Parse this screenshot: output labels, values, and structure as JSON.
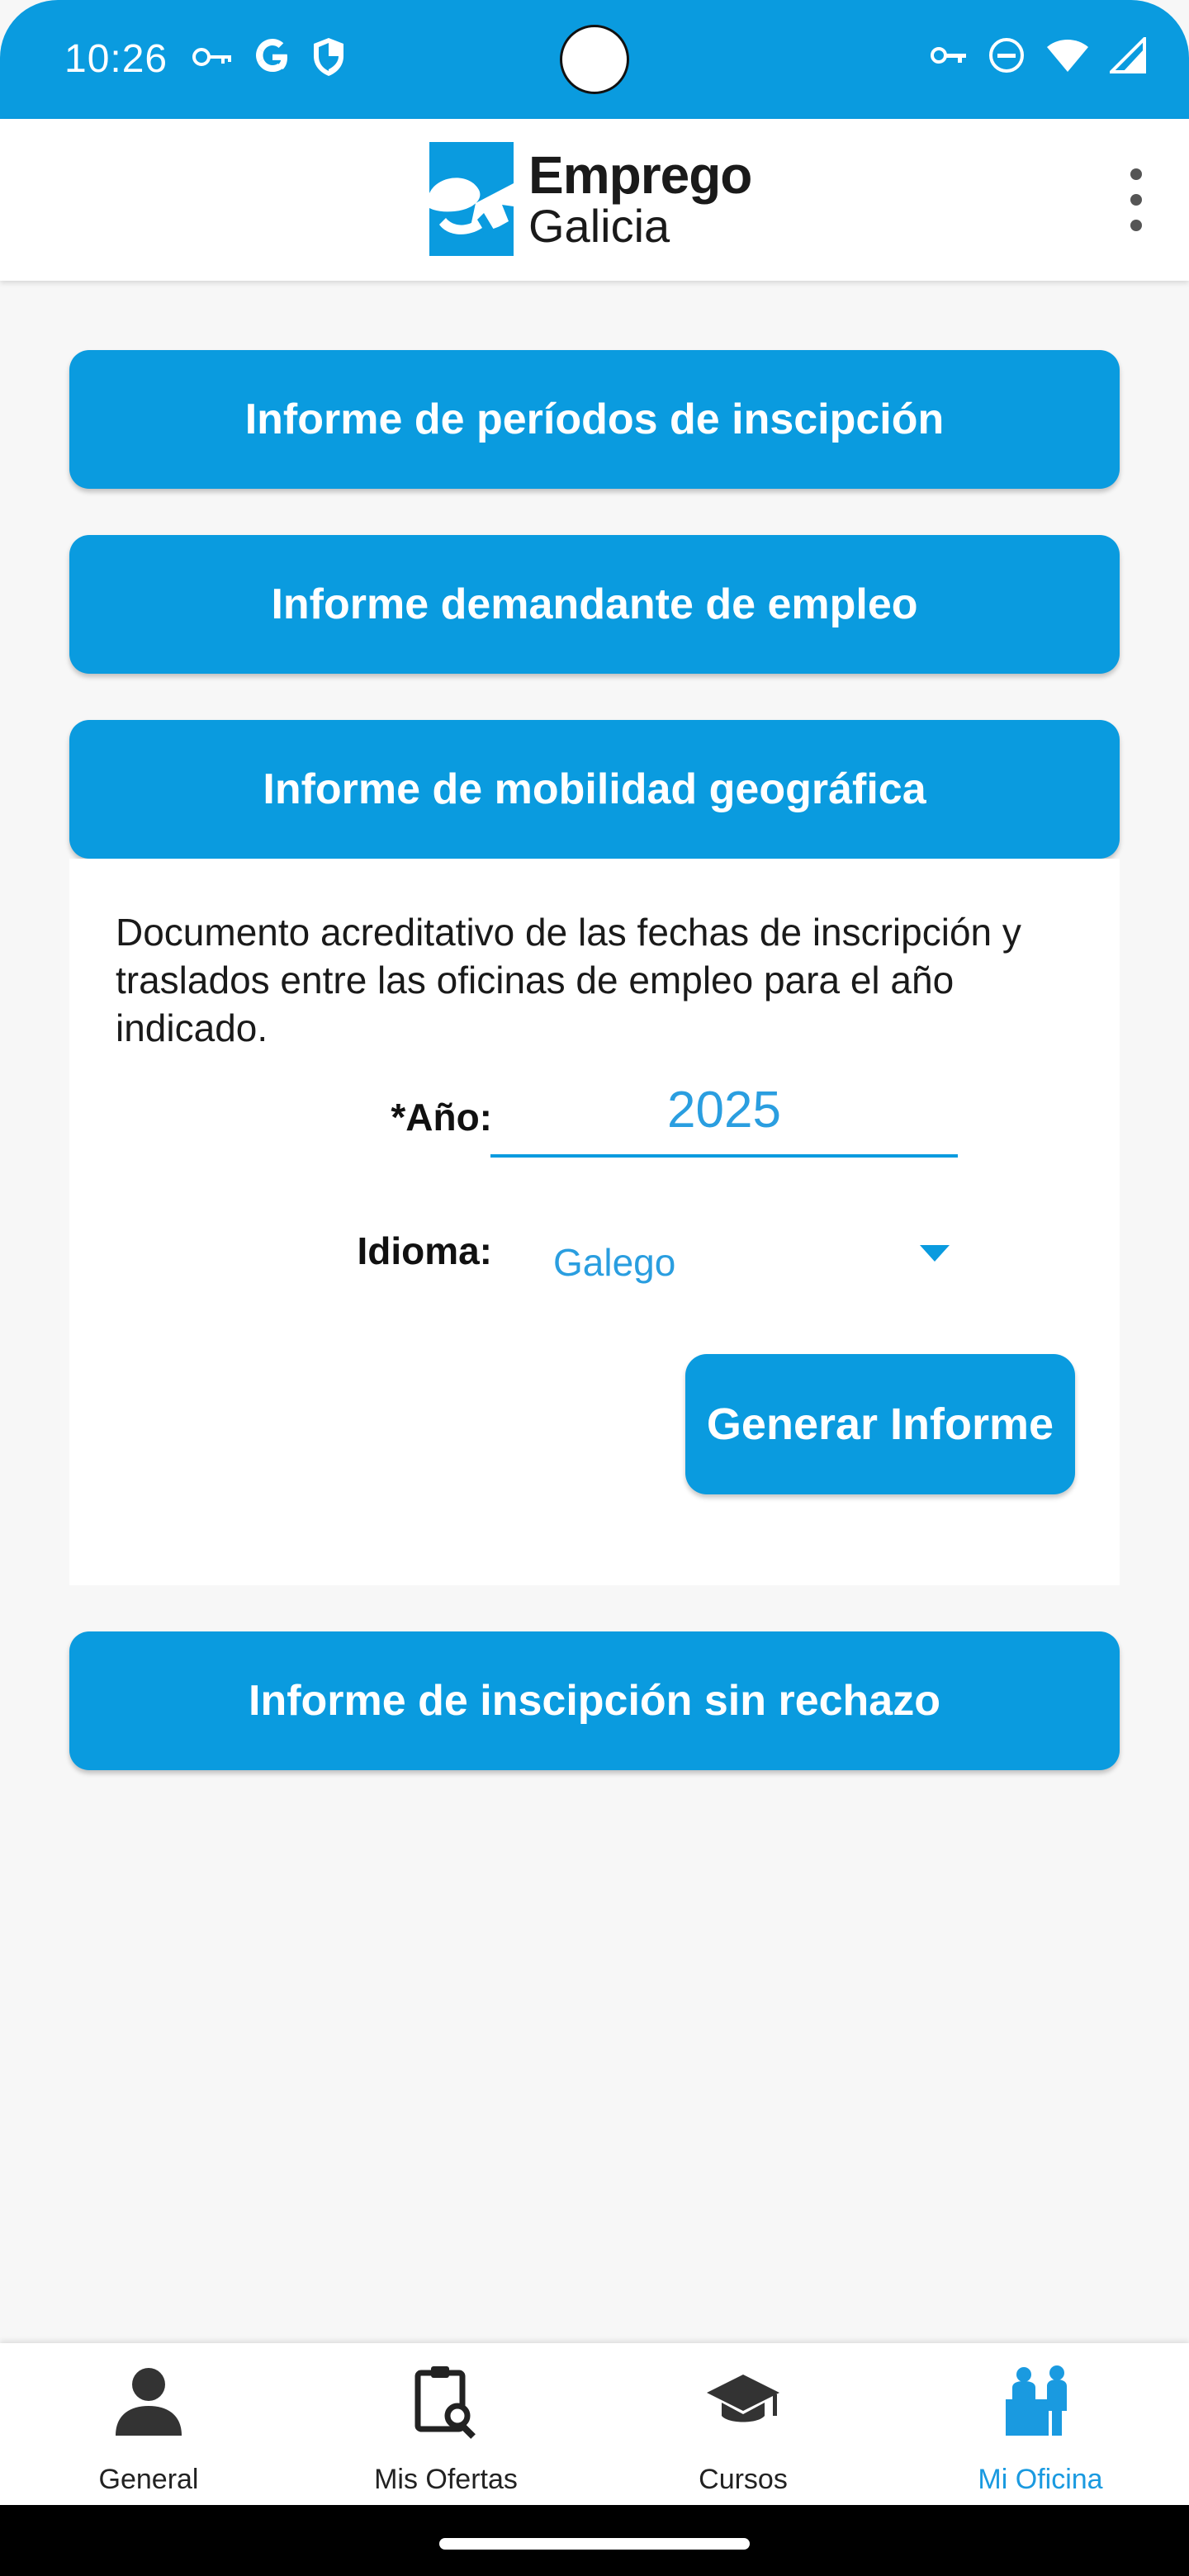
{
  "status_bar": {
    "time": "10:26"
  },
  "header": {
    "brand_line1": "Emprego",
    "brand_line2": "Galicia"
  },
  "reports": {
    "item1": "Informe de períodos de inscipción",
    "item2": "Informe demandante de empleo",
    "item3": "Informe de mobilidad geográfica",
    "item4": "Informe de inscipción sin rechazo"
  },
  "panel": {
    "description": "Documento acreditativo de las fechas de inscripción y traslados entre las oficinas de empleo para el año indicado.",
    "year_label": "*Año:",
    "year_value": "2025",
    "language_label": "Idioma:",
    "language_value": "Galego",
    "generate_label": "Generar Informe"
  },
  "bottom_nav": {
    "general": "General",
    "ofertas": "Mis Ofertas",
    "cursos": "Cursos",
    "oficina": "Mi Oficina"
  },
  "colors": {
    "primary": "#0a9bdf",
    "active_nav": "#1a9ae0",
    "text_dark": "#1a1a1a"
  }
}
